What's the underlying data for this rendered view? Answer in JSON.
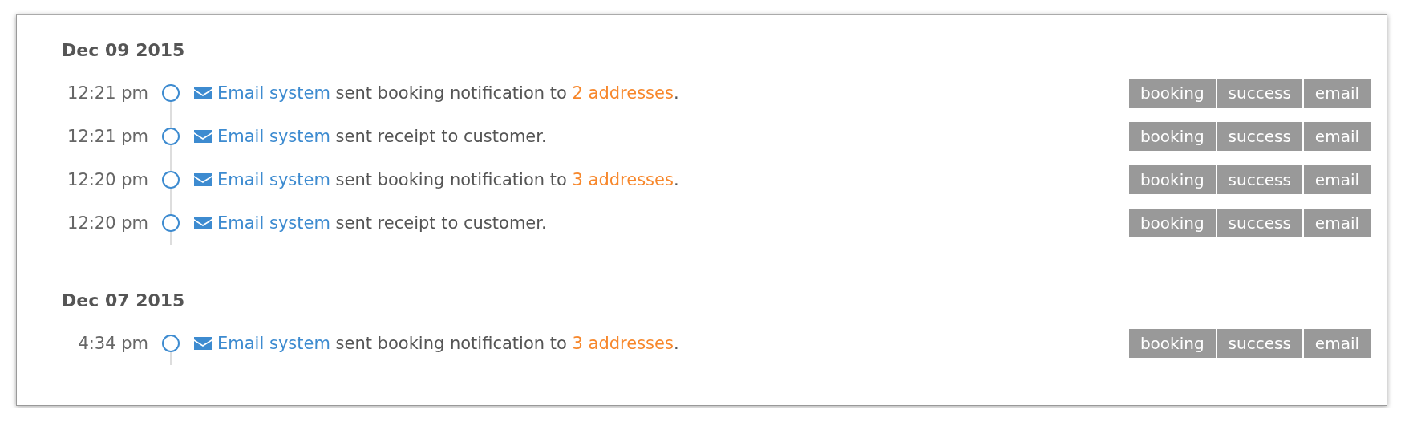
{
  "days": [
    {
      "date": "Dec 09 2015",
      "events": [
        {
          "time": "12:21 pm",
          "parts": [
            {
              "kind": "actor",
              "text": "Email system"
            },
            {
              "kind": "plain",
              "text": " sent booking notification to "
            },
            {
              "kind": "count",
              "text": "2 addresses"
            },
            {
              "kind": "plain",
              "text": "."
            }
          ],
          "tags": [
            "booking",
            "success",
            "email"
          ]
        },
        {
          "time": "12:21 pm",
          "parts": [
            {
              "kind": "actor",
              "text": "Email system"
            },
            {
              "kind": "plain",
              "text": " sent receipt to customer."
            }
          ],
          "tags": [
            "booking",
            "success",
            "email"
          ]
        },
        {
          "time": "12:20 pm",
          "parts": [
            {
              "kind": "actor",
              "text": "Email system"
            },
            {
              "kind": "plain",
              "text": " sent booking notification to "
            },
            {
              "kind": "count",
              "text": "3 addresses"
            },
            {
              "kind": "plain",
              "text": "."
            }
          ],
          "tags": [
            "booking",
            "success",
            "email"
          ]
        },
        {
          "time": "12:20 pm",
          "parts": [
            {
              "kind": "actor",
              "text": "Email system"
            },
            {
              "kind": "plain",
              "text": " sent receipt to customer."
            }
          ],
          "tags": [
            "booking",
            "success",
            "email"
          ]
        }
      ]
    },
    {
      "date": "Dec 07 2015",
      "events": [
        {
          "time": "4:34 pm",
          "parts": [
            {
              "kind": "actor",
              "text": "Email system"
            },
            {
              "kind": "plain",
              "text": " sent booking notification to "
            },
            {
              "kind": "count",
              "text": "3 addresses"
            },
            {
              "kind": "plain",
              "text": "."
            }
          ],
          "tags": [
            "booking",
            "success",
            "email"
          ]
        }
      ]
    }
  ]
}
